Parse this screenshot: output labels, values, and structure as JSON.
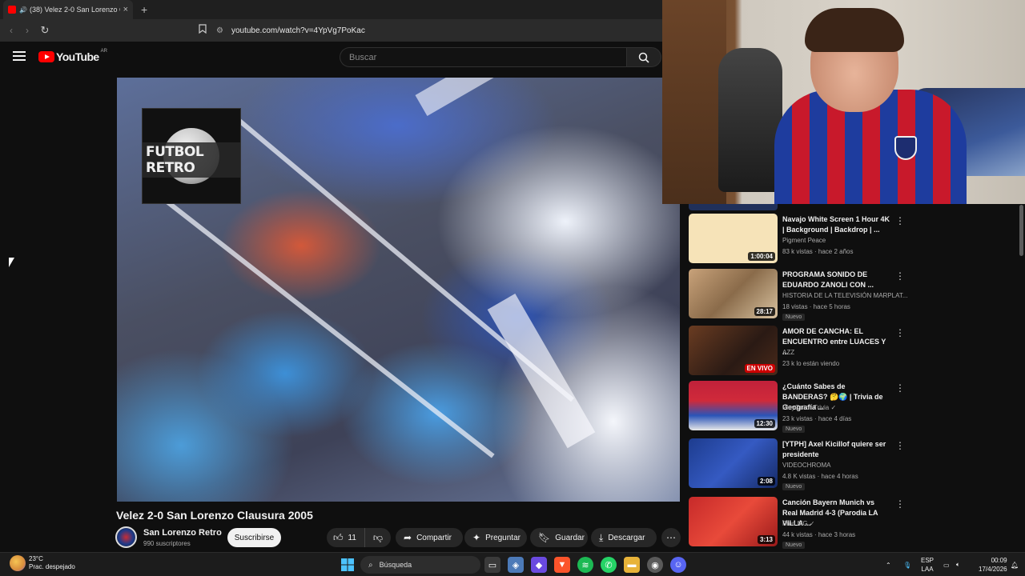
{
  "browser": {
    "tab_title": "(38) Velez 2-0 San Lorenzo Cl",
    "tab_speaker": "🔊",
    "new_tab": "+",
    "url": "youtube.com/watch?v=4YpVg7PoKac"
  },
  "youtube": {
    "logo_text": "YouTube",
    "logo_country": "AR",
    "search_placeholder": "Buscar"
  },
  "video": {
    "watermark": "FUTBOL RETRO",
    "title": "Velez 2-0 San Lorenzo Clausura 2005",
    "channel": "San Lorenzo Retro",
    "subscribers": "990 suscriptores",
    "subscribe_label": "Suscribirse",
    "likes": "11",
    "actions": {
      "share": "Compartir",
      "ask": "Preguntar",
      "save": "Guardar",
      "download": "Descargar"
    }
  },
  "recommendations": [
    {
      "title": "Navajo White Screen 1 Hour 4K | Background | Backdrop | ...",
      "channel": "Pigment Peace",
      "meta": "83 k vistas · hace 2 años",
      "duration": "1:00:04",
      "badge": ""
    },
    {
      "title": "PROGRAMA SONIDO DE EDUARDO ZANOLI CON ...",
      "channel": "HISTORIA DE LA TELEVISIÓN MARPLAT...",
      "meta": "18 vistas · hace 5 horas",
      "duration": "28:17",
      "badge": "Nuevo"
    },
    {
      "title": "AMOR DE CANCHA: EL ENCUENTRO entre LUACES Y ...",
      "channel": "AZZ",
      "meta": "23 k lo están viendo",
      "duration": "EN VIVO",
      "badge": ""
    },
    {
      "title": "¿Cuánto Sabes de BANDERAS? 🤔🌍 | Trivia de Geografía ...",
      "channel": "PlayQuiz - Trivia ✓",
      "meta": "23 k vistas · hace 4 días",
      "duration": "12:30",
      "badge": "Nuevo"
    },
    {
      "title": "[YTPH] Axel Kicillof quiere ser presidente",
      "channel": "VIDEOCHROMA",
      "meta": "4.8 K vistas · hace 4 horas",
      "duration": "2:08",
      "badge": "Nuevo"
    },
    {
      "title": "Canción Bayern Munich vs Real Madrid 4-3 (Parodia LA VILLA ...",
      "channel": "Fran MG ✓",
      "meta": "44 k vistas · hace 3 horas",
      "duration": "3:13",
      "badge": "Nuevo"
    }
  ],
  "taskbar": {
    "temperature": "23°C",
    "weather": "Prac. despejado",
    "search_label": "Búsqueda",
    "lang_top": "ESP",
    "lang_bottom": "LAA",
    "time": "00:09",
    "date": "17/4/2026"
  },
  "colors": {
    "background": "#0f0f0f",
    "brand_red": "#ff0000",
    "pill": "#272727"
  }
}
